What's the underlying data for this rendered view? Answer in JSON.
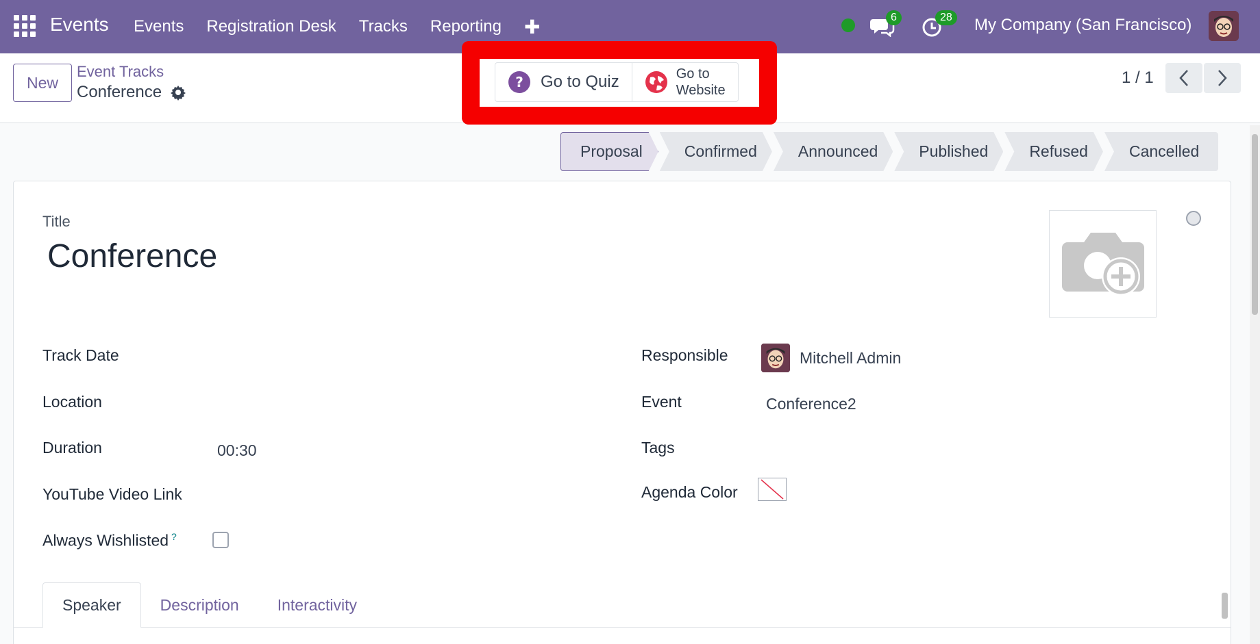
{
  "navbar": {
    "brand": "Events",
    "menu": [
      "Events",
      "Registration Desk",
      "Tracks",
      "Reporting"
    ],
    "messages_count": "6",
    "activities_count": "28",
    "company": "My Company (San Francisco)"
  },
  "control": {
    "new_label": "New",
    "breadcrumb": "Event Tracks",
    "record_title": "Conference",
    "smart_quiz": "Go to Quiz",
    "smart_website_line1": "Go to",
    "smart_website_line2": "Website",
    "pager": "1 / 1"
  },
  "stages": [
    "Proposal",
    "Confirmed",
    "Announced",
    "Published",
    "Refused",
    "Cancelled"
  ],
  "form": {
    "title_label": "Title",
    "title_value": "Conference",
    "track_date_label": "Track Date",
    "location_label": "Location",
    "duration_label": "Duration",
    "duration_value": "00:30",
    "youtube_label": "YouTube Video Link",
    "wishlisted_label": "Always Wishlisted",
    "wishlisted_help": "?",
    "responsible_label": "Responsible",
    "responsible_value": "Mitchell Admin",
    "event_label": "Event",
    "event_value": "Conference2",
    "tags_label": "Tags",
    "agenda_color_label": "Agenda Color"
  },
  "tabs": [
    "Speaker",
    "Description",
    "Interactivity"
  ],
  "colors": {
    "navbar": "#71639e",
    "accent": "#71639e",
    "badge": "#1e9b28",
    "highlight": "#f50000",
    "quiz_icon": "#7c4e9e",
    "website_icon": "#e4324b"
  },
  "icons": [
    "apps-icon",
    "plus-icon",
    "chat-icon",
    "clock-icon",
    "gear-icon",
    "question-icon",
    "globe-icon",
    "chevron-left-icon",
    "chevron-right-icon",
    "camera-plus-icon"
  ]
}
